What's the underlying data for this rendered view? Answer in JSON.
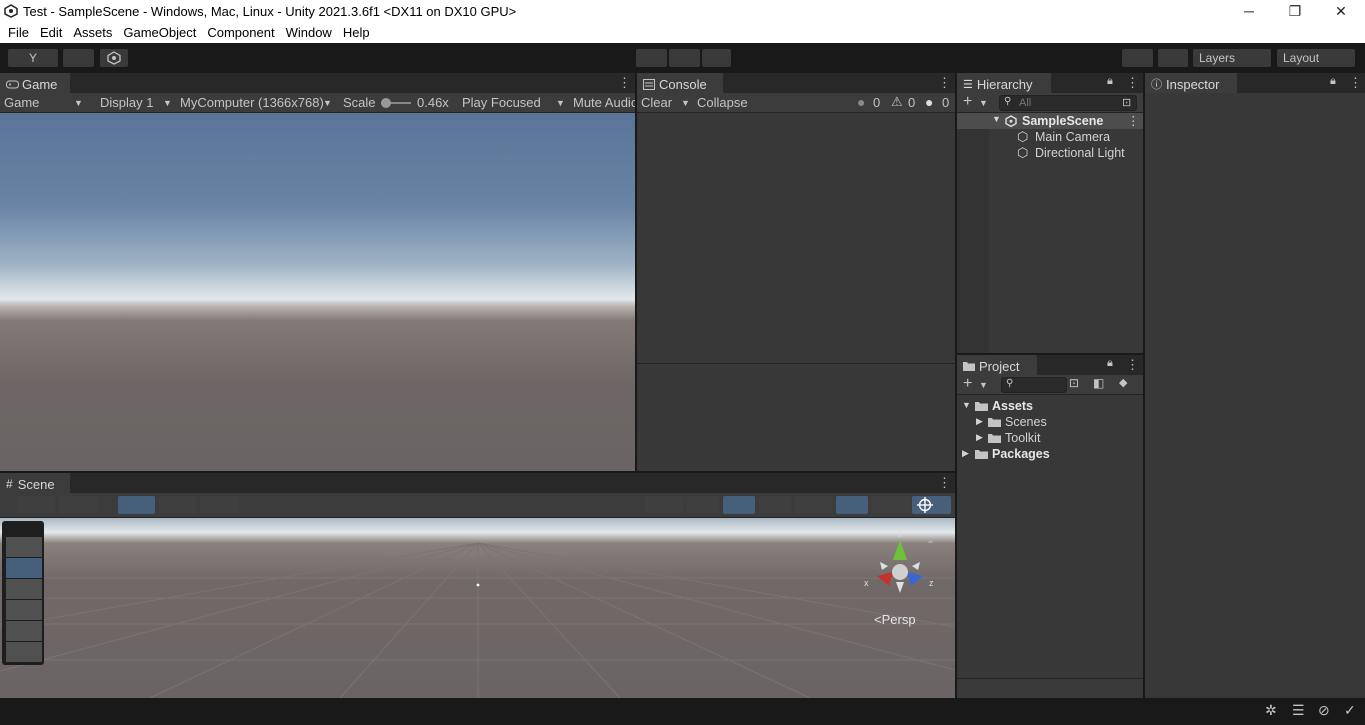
{
  "window": {
    "title": "Test - SampleScene - Windows, Mac, Linux - Unity 2021.3.6f1 <DX11 on DX10 GPU>",
    "controls": {
      "minimize": "─",
      "restore": "❐",
      "close": "✕"
    }
  },
  "menu": [
    "File",
    "Edit",
    "Assets",
    "GameObject",
    "Component",
    "Window",
    "Help"
  ],
  "toolbar": {
    "account_label": "Y",
    "layers_label": "Layers",
    "layout_label": "Layout"
  },
  "game": {
    "tab_label": "Game",
    "view_mode": "Game",
    "display": "Display 1",
    "resolution": "MyComputer (1366x768)",
    "scale_label": "Scale",
    "scale_value": "0.46x",
    "play_mode": "Play Focused",
    "mute_label": "Mute Audio",
    "scale_slider_fraction": 0.0
  },
  "console": {
    "tab_label": "Console",
    "clear_label": "Clear",
    "collapse_label": "Collapse",
    "info_count": "0",
    "warning_count": "0",
    "error_count": "0"
  },
  "hierarchy": {
    "tab_label": "Hierarchy",
    "search_placeholder": "All",
    "scene": "SampleScene",
    "objects": [
      "Main Camera",
      "Directional Light"
    ]
  },
  "inspector": {
    "tab_label": "Inspector"
  },
  "project": {
    "tab_label": "Project",
    "root": "Assets",
    "folders": [
      "Scenes",
      "Toolkit"
    ],
    "packages": "Packages"
  },
  "scene": {
    "tab_label": "Scene",
    "gizmo_axes": {
      "x": "x",
      "y": "y",
      "z": "z"
    },
    "persp_label": "Persp"
  },
  "colors": {
    "accent": "#46607c",
    "selection": "#4d4d4d",
    "panel": "#383838"
  }
}
